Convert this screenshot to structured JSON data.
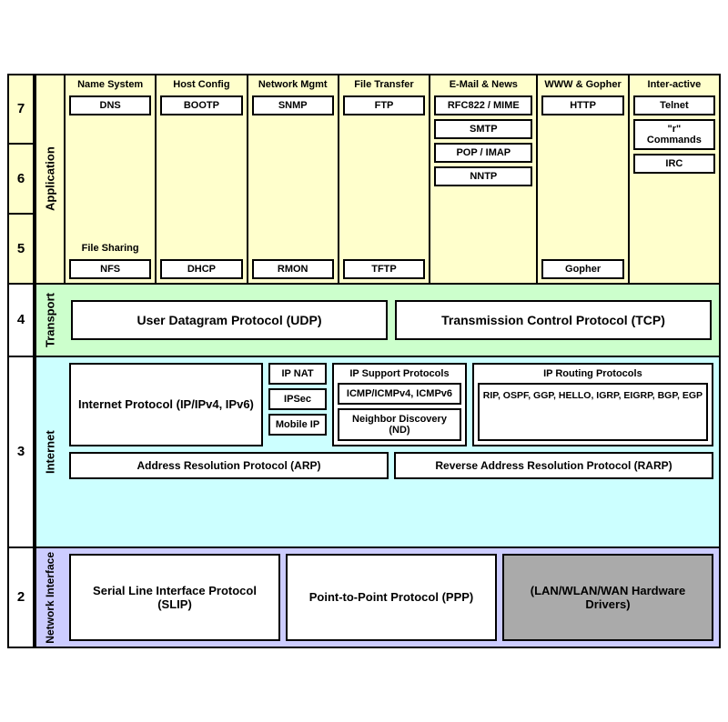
{
  "layers": {
    "application": {
      "numbers": [
        "7",
        "6",
        "5"
      ],
      "name": "Application",
      "sections": [
        {
          "title": "Name System",
          "items": [
            "DNS"
          ],
          "below_title": "File Sharing",
          "below_items": [
            "NFS"
          ]
        },
        {
          "title": "Host Config",
          "items": [
            "BOOTP",
            "DHCP"
          ]
        },
        {
          "title": "Network Mgmt",
          "items": [
            "SNMP",
            "RMON"
          ]
        },
        {
          "title": "File Transfer",
          "items": [
            "FTP",
            "TFTP"
          ]
        },
        {
          "title": "E-Mail & News",
          "items": [
            "RFC822 / MIME",
            "SMTP",
            "POP / IMAP",
            "NNTP"
          ]
        },
        {
          "title": "WWW & Gopher",
          "items": [
            "HTTP",
            "Gopher"
          ]
        },
        {
          "title": "Inter-active",
          "items": [
            "Telnet",
            "\"r\" Commands",
            "IRC"
          ]
        }
      ]
    },
    "transport": {
      "number": "4",
      "name": "Transport",
      "udp": "User Datagram Protocol (UDP)",
      "tcp": "Transmission Control Protocol (TCP)"
    },
    "internet": {
      "number": "3",
      "name": "Internet",
      "ip_main": "Internet Protocol (IP/IPv4, IPv6)",
      "ip_sub": [
        "IP NAT",
        "IPSec",
        "Mobile IP"
      ],
      "support_title": "IP Support Protocols",
      "support_items": [
        "ICMP/ICMPv4, ICMPv6",
        "Neighbor Discovery (ND)"
      ],
      "routing_title": "IP Routing Protocols",
      "routing_content": "RIP, OSPF, GGP, HELLO, IGRP, EIGRP, BGP, EGP",
      "arp": "Address Resolution Protocol (ARP)",
      "rarp": "Reverse Address Resolution Protocol (RARP)"
    },
    "network_interface": {
      "number": "2",
      "name": "Network Interface",
      "slip": "Serial Line Interface Protocol (SLIP)",
      "ppp": "Point-to-Point Protocol (PPP)",
      "hw": "(LAN/WLAN/WAN Hardware Drivers)"
    }
  }
}
